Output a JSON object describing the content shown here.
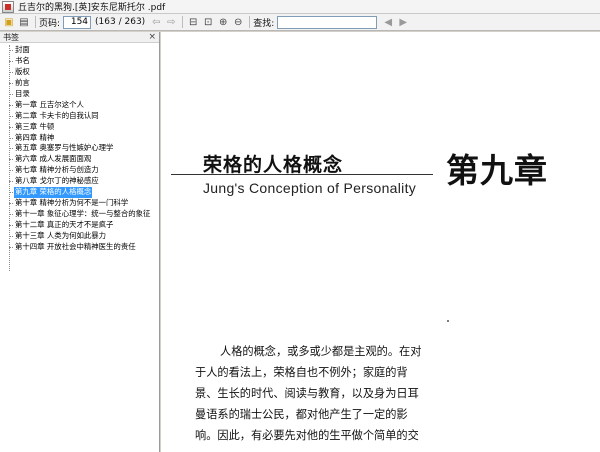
{
  "window": {
    "title": "丘吉尔的黑狗.[英]安东尼斯托尔 .pdf"
  },
  "toolbar": {
    "page_label": "页码:",
    "page_value": "154",
    "page_total": "(163 / 263)",
    "search_label": "查找:",
    "search_value": ""
  },
  "sidebar": {
    "title": "书签",
    "close_glyph": "×",
    "items": [
      {
        "label": "封面"
      },
      {
        "label": "书名"
      },
      {
        "label": "版权"
      },
      {
        "label": "前言"
      },
      {
        "label": "目录"
      },
      {
        "label": "第一章 丘吉尔这个人"
      },
      {
        "label": "第二章 卡夫卡的自我认同"
      },
      {
        "label": "第三章 牛顿"
      },
      {
        "label": "第四章 精神"
      },
      {
        "label": "第五章 奥塞罗与性嫉妒心理学"
      },
      {
        "label": "第六章 成人发展面面观"
      },
      {
        "label": "第七章 精神分析与创造力"
      },
      {
        "label": "第八章 戈尔丁的神秘感应"
      },
      {
        "label": "第九章 荣格的人格概念"
      },
      {
        "label": "第十章 精神分析为何不是一门科学"
      },
      {
        "label": "第十一章 象征心理学：统一与整合的象征"
      },
      {
        "label": "第十二章 真正的天才不是疯子"
      },
      {
        "label": "第十三章 人类为何如此暴力"
      },
      {
        "label": "第十四章 开放社会中精神医生的责任"
      }
    ]
  },
  "document": {
    "chapter_title_cn": "荣格的人格概念",
    "chapter_title_en": "Jung's Conception of Personality",
    "chapter_number": "第九章",
    "paragraph_lines": [
      "人格的概念，或多或少都是主观的。在对",
      "于人的看法上，荣格自也不例外；家庭的背",
      "景、生长的时代、阅读与教育，以及身为日耳",
      "曼语系的瑞士公民，都对他产生了一定的影",
      "响。因此，有必要先对他的生平做个简单的交"
    ]
  },
  "colors": {
    "selection": "#3399ff",
    "sidebar_bg": "#ffffff",
    "toolbar_bg": "#f2f2f2"
  }
}
